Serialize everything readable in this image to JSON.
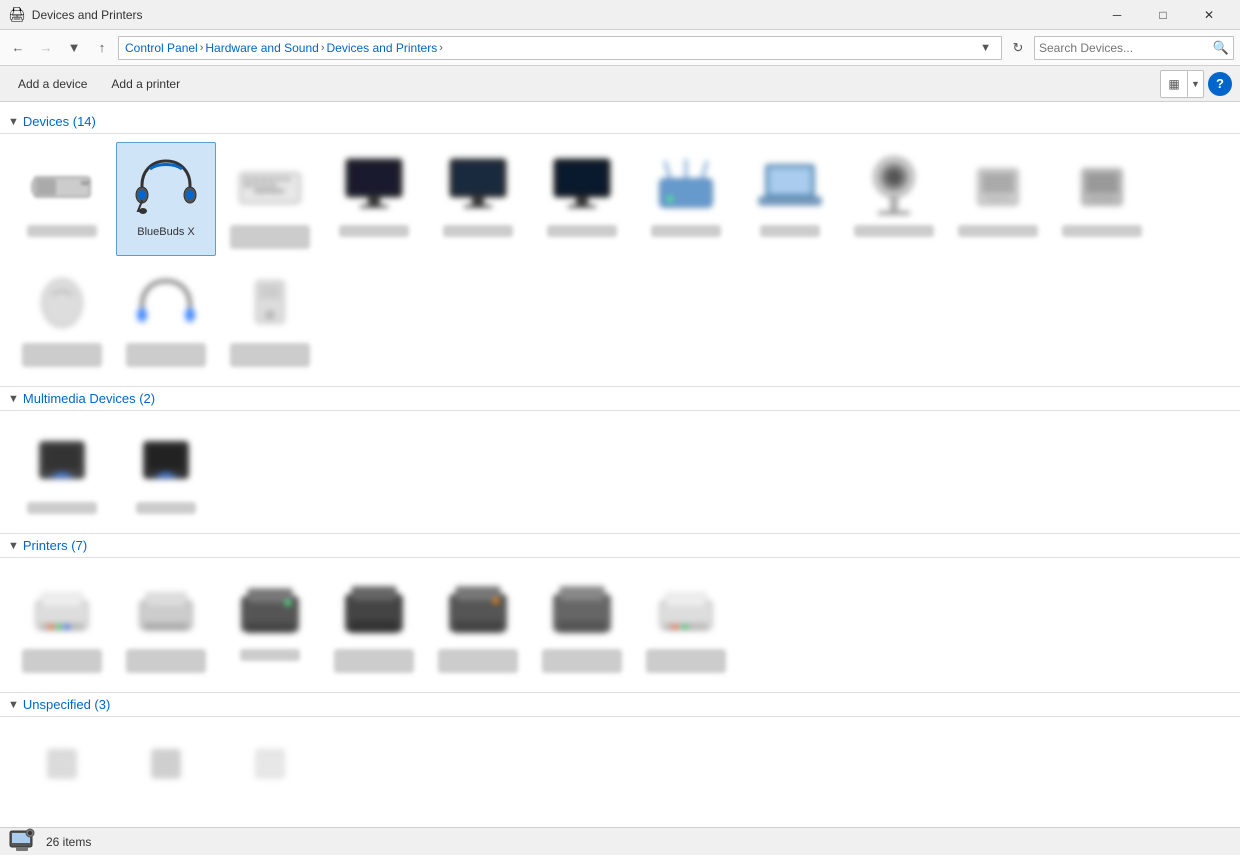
{
  "window": {
    "title": "Devices and Printers",
    "icon": "🖨"
  },
  "titlebar": {
    "minimize_label": "─",
    "maximize_label": "□",
    "close_label": "✕"
  },
  "addressbar": {
    "back_tooltip": "Back",
    "forward_tooltip": "Forward",
    "up_tooltip": "Up",
    "breadcrumbs": [
      {
        "label": "Control Panel"
      },
      {
        "label": "Hardware and Sound"
      },
      {
        "label": "Devices and Printers"
      }
    ],
    "search_placeholder": "Search Devices...",
    "search_icon": "🔍"
  },
  "toolbar": {
    "add_device_label": "Add a device",
    "add_printer_label": "Add a printer",
    "view_label": "▦",
    "view_dropdown": "▾",
    "help_label": "?"
  },
  "sections": [
    {
      "id": "devices",
      "title": "Devices",
      "count": 14,
      "expanded": true
    },
    {
      "id": "multimedia",
      "title": "Multimedia Devices",
      "count": 2,
      "expanded": true
    },
    {
      "id": "printers",
      "title": "Printers",
      "count": 7,
      "expanded": true
    },
    {
      "id": "unspecified",
      "title": "Unspecified",
      "count": 3,
      "expanded": true
    }
  ],
  "statusbar": {
    "count_label": "26 items"
  },
  "devices_section": {
    "items": [
      {
        "id": "d1",
        "label": "",
        "blurred": true,
        "selected": false,
        "type": "usb"
      },
      {
        "id": "d2",
        "label": "BlueBuds X",
        "blurred": false,
        "selected": true,
        "type": "headset"
      },
      {
        "id": "d3",
        "label": "",
        "blurred": true,
        "selected": false,
        "type": "keyboard"
      },
      {
        "id": "d4",
        "label": "",
        "blurred": true,
        "selected": false,
        "type": "monitor"
      },
      {
        "id": "d5",
        "label": "",
        "blurred": true,
        "selected": false,
        "type": "monitor2"
      },
      {
        "id": "d6",
        "label": "",
        "blurred": true,
        "selected": false,
        "type": "monitor3"
      },
      {
        "id": "d7",
        "label": "",
        "blurred": true,
        "selected": false,
        "type": "router"
      },
      {
        "id": "d8",
        "label": "",
        "blurred": true,
        "selected": false,
        "type": "laptop"
      },
      {
        "id": "d9",
        "label": "",
        "blurred": true,
        "selected": false,
        "type": "webcam"
      },
      {
        "id": "d10",
        "label": "",
        "blurred": true,
        "selected": false,
        "type": "device1"
      },
      {
        "id": "d11",
        "label": "",
        "blurred": true,
        "selected": false,
        "type": "device2"
      },
      {
        "id": "d12",
        "label": "",
        "blurred": true,
        "selected": false,
        "type": "mouse"
      },
      {
        "id": "d13",
        "label": "",
        "blurred": true,
        "selected": false,
        "type": "headset2"
      },
      {
        "id": "d14",
        "label": "",
        "blurred": true,
        "selected": false,
        "type": "box"
      }
    ]
  },
  "multimedia_section": {
    "items": [
      {
        "id": "m1",
        "label": "",
        "blurred": true,
        "type": "computer1"
      },
      {
        "id": "m2",
        "label": "",
        "blurred": true,
        "type": "computer2"
      }
    ]
  },
  "printers_section": {
    "items": [
      {
        "id": "p1",
        "label": "",
        "blurred": true,
        "type": "printer1"
      },
      {
        "id": "p2",
        "label": "",
        "blurred": true,
        "type": "printer2"
      },
      {
        "id": "p3",
        "label": "",
        "blurred": true,
        "type": "printer3"
      },
      {
        "id": "p4",
        "label": "",
        "blurred": true,
        "type": "printer4"
      },
      {
        "id": "p5",
        "label": "",
        "blurred": true,
        "type": "printer5"
      },
      {
        "id": "p6",
        "label": "",
        "blurred": true,
        "type": "printer6"
      },
      {
        "id": "p7",
        "label": "",
        "blurred": true,
        "type": "printer7"
      }
    ]
  },
  "unspecified_section": {
    "items": [
      {
        "id": "u1",
        "label": "",
        "blurred": true,
        "type": "device"
      },
      {
        "id": "u2",
        "label": "",
        "blurred": true,
        "type": "device"
      },
      {
        "id": "u3",
        "label": "",
        "blurred": true,
        "type": "device"
      }
    ]
  }
}
